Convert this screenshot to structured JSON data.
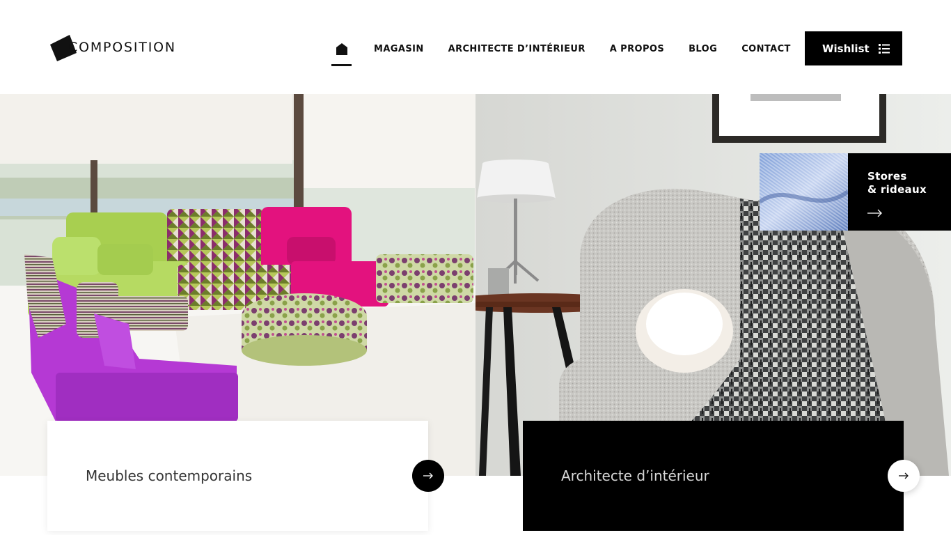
{
  "brand": {
    "name": "COMPOSITION",
    "accent": "#000000"
  },
  "nav": {
    "home_icon": "home-icon",
    "items": [
      {
        "label": "MAGASIN"
      },
      {
        "label": "ARCHITECTE D’INTÉRIEUR"
      },
      {
        "label": "A PROPOS"
      },
      {
        "label": "BLOG"
      },
      {
        "label": "CONTACT"
      }
    ]
  },
  "wishlist": {
    "label": "Wishlist",
    "icon": "list-icon"
  },
  "promo": {
    "title": "Stores\n& rideaux",
    "icon": "arrow-right-icon"
  },
  "cards": [
    {
      "title": "Meubles contemporains",
      "icon": "arrow-right-icon"
    },
    {
      "title": "Architecte d’intérieur",
      "icon": "arrow-right-icon"
    }
  ]
}
